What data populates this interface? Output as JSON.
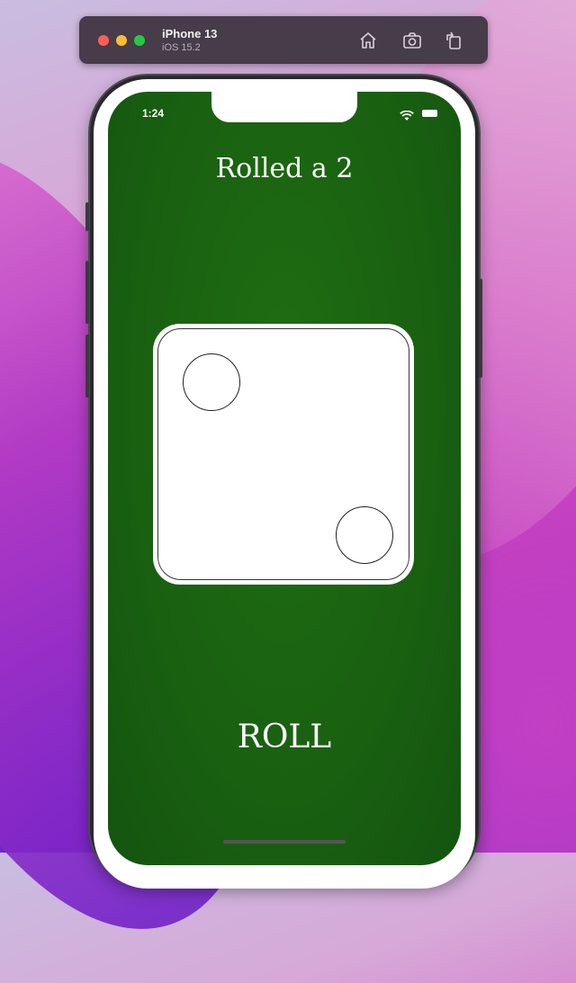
{
  "simulator": {
    "device_name": "iPhone 13",
    "os_version": "iOS 15.2",
    "icons": [
      "home-icon",
      "screenshot-icon",
      "rotate-icon"
    ]
  },
  "status_bar": {
    "time": "1:24",
    "icons": [
      "wifi-icon",
      "battery-icon"
    ]
  },
  "app": {
    "title": "Rolled a 2",
    "die_value": 2,
    "roll_label": "ROLL"
  },
  "colors": {
    "table_green": "#196011",
    "die_white": "#ffffff"
  }
}
